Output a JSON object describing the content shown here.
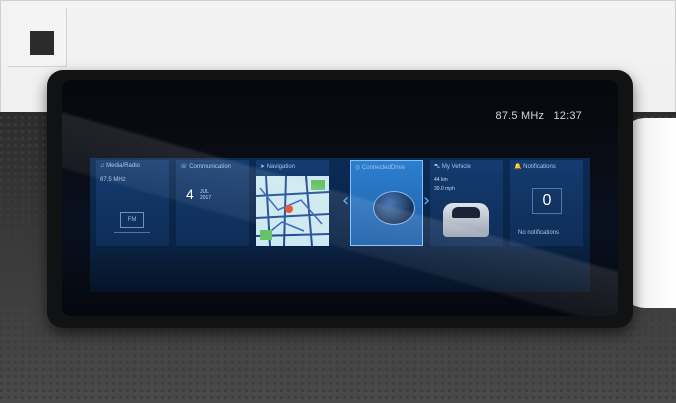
{
  "status": {
    "radio_frequency": "87.5 MHz",
    "time": "12:37"
  },
  "tiles": {
    "media": {
      "title": "Media/Radio",
      "frequency": "87.5 MHz",
      "band": "FM"
    },
    "communication": {
      "title": "Communication",
      "day": "4",
      "month": "JUL",
      "year": "2017"
    },
    "navigation": {
      "title": "Navigation"
    },
    "connected": {
      "title": "ConnectedDrive"
    },
    "vehicle": {
      "title": "My Vehicle",
      "range": "44 km",
      "consumption": "30.0 mph"
    },
    "notifications": {
      "title": "Notifications",
      "count": "0",
      "empty_text": "No notifications"
    }
  },
  "arrows": {
    "left": "‹",
    "right": "›"
  },
  "colors": {
    "accent": "#7fc2ff",
    "tile": "#143b70",
    "active_tile": "#2b7fcf"
  },
  "icons": {
    "corner": "stop-square-icon",
    "music": "music-note-icon",
    "phone": "phone-icon",
    "navigation": "navigation-icon",
    "connected": "connected-icon",
    "vehicle": "car-icon",
    "notifications": "bell-icon"
  }
}
